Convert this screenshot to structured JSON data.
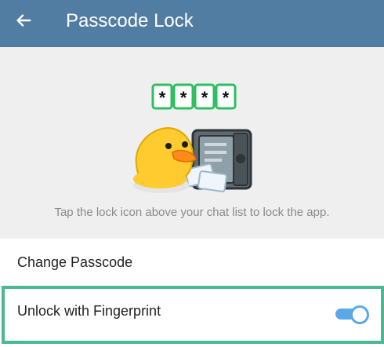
{
  "app_bar": {
    "title": "Passcode Lock",
    "back_icon": "arrow-left-icon"
  },
  "hero": {
    "passcode_boxes": [
      "*",
      "*",
      "*",
      "*"
    ],
    "illustration": "duck-with-safe-sticker",
    "hint": "Tap the lock icon above your chat list to lock the app."
  },
  "settings": {
    "change_passcode_label": "Change Passcode",
    "fingerprint_label": "Unlock with Fingerprint",
    "fingerprint_enabled": true
  },
  "colors": {
    "header": "#527da3",
    "hero_bg": "#efefef",
    "toggle_accent": "#5aa9e6",
    "highlight": "#4bb894",
    "code_box_border": "#2fbe62"
  }
}
